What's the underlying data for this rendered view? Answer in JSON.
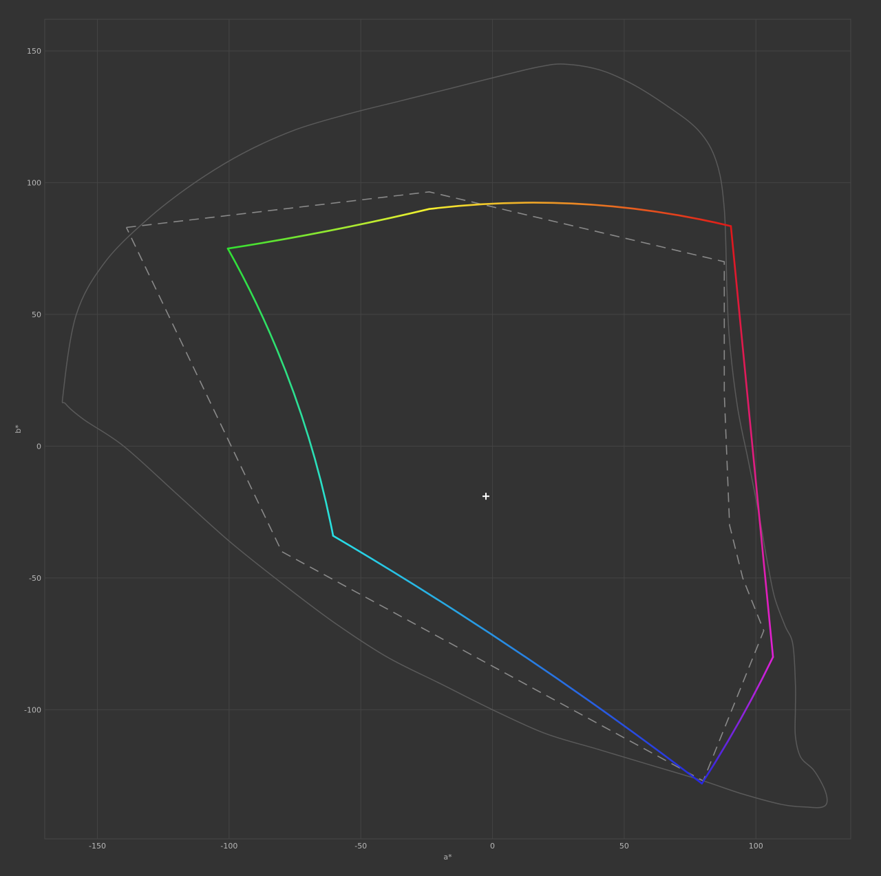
{
  "chart_data": {
    "type": "line",
    "title": "",
    "xlabel": "a*",
    "ylabel": "b*",
    "xlim": [
      -170,
      136
    ],
    "ylim": [
      -149,
      162
    ],
    "grid": true,
    "x_ticks": [
      -150,
      -100,
      -50,
      0,
      50,
      100
    ],
    "y_ticks": [
      150,
      100,
      50,
      0,
      -50,
      -100
    ],
    "white_point": {
      "x": -2.5,
      "y": -19,
      "marker": "plus",
      "color": "#ffffff"
    },
    "series": [
      {
        "style": "solid",
        "color": "#5a5a5a",
        "closed": true,
        "x": [
          -163,
          -158,
          -147,
          -130,
          -113,
          -95,
          -75,
          -55,
          -35,
          -15,
          5,
          18,
          27,
          40,
          52,
          65,
          78,
          85,
          88,
          89,
          90,
          93,
          97,
          101,
          104,
          107,
          111,
          114,
          115,
          115,
          115,
          117,
          122,
          126,
          127,
          125,
          120,
          110,
          95,
          80,
          60,
          40,
          20,
          0,
          -20,
          -40,
          -60,
          -80,
          -100,
          -120,
          -140,
          -155,
          -162
        ],
        "y": [
          20,
          50,
          70,
          87,
          100,
          111,
          120,
          126,
          131,
          136,
          141,
          144,
          145,
          143,
          138,
          130,
          120,
          108,
          90,
          60,
          40,
          15,
          -5,
          -25,
          -42,
          -57,
          -68,
          -75,
          -90,
          -100,
          -110,
          -118,
          -123,
          -130,
          -135,
          -137,
          -137,
          -136,
          -132,
          -127,
          -121,
          -115,
          -109,
          -100,
          -90,
          -80,
          -67,
          -52,
          -36,
          -18,
          0,
          10,
          16
        ]
      },
      {
        "style": "dashed",
        "color": "#8a8a8a",
        "closed": true,
        "x": [
          -139,
          -24,
          88,
          88,
          90,
          95,
          103,
          80,
          -80,
          -139
        ],
        "y": [
          83,
          96.5,
          70,
          20,
          -30,
          -50,
          -70,
          -127,
          -40,
          83
        ]
      },
      {
        "style": "solid-gradient",
        "closed": true,
        "x": [
          -100.5,
          -24,
          90.5,
          106.5,
          79.5,
          -60.5,
          -100.5
        ],
        "y": [
          75,
          90,
          83.5,
          -80,
          -128,
          -34,
          75
        ],
        "vertex_colors": [
          "#32e032",
          "#f5f030",
          "#e01818",
          "#e020d8",
          "#2828e0",
          "#28e0e6"
        ]
      }
    ]
  }
}
